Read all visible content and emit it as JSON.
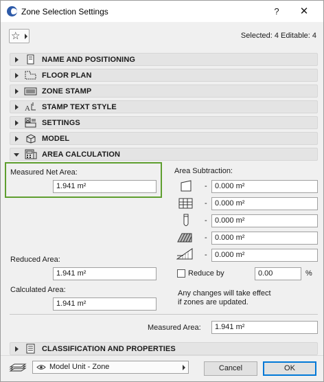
{
  "window": {
    "title": "Zone Selection Settings",
    "help": "?",
    "close": "✕"
  },
  "toolbar": {
    "favorites_icon": "star-icon",
    "selected_info": "Selected: 4 Editable: 4"
  },
  "panels": [
    {
      "label": "NAME AND POSITIONING",
      "icon": "name-positioning-icon",
      "expanded": false
    },
    {
      "label": "FLOOR PLAN",
      "icon": "floor-plan-icon",
      "expanded": false
    },
    {
      "label": "ZONE STAMP",
      "icon": "zone-stamp-icon",
      "expanded": false
    },
    {
      "label": "STAMP TEXT STYLE",
      "icon": "text-style-icon",
      "expanded": false
    },
    {
      "label": "SETTINGS",
      "icon": "settings-icon",
      "expanded": false
    },
    {
      "label": "MODEL",
      "icon": "model-icon",
      "expanded": false
    },
    {
      "label": "AREA CALCULATION",
      "icon": "area-calculation-icon",
      "expanded": true
    },
    {
      "label": "CLASSIFICATION AND PROPERTIES",
      "icon": "classification-icon",
      "expanded": false
    }
  ],
  "area": {
    "measured_net_label": "Measured Net Area:",
    "measured_net_value": "1.941 m²",
    "subtraction_label": "Area Subtraction:",
    "subtractions": [
      {
        "icon": "wall-niche-icon",
        "dash": "-",
        "value": "0.000 m²"
      },
      {
        "icon": "grid-icon",
        "dash": "-",
        "value": "0.000 m²"
      },
      {
        "icon": "column-icon",
        "dash": "-",
        "value": "0.000 m²"
      },
      {
        "icon": "hatched-fill-icon",
        "dash": "-",
        "value": "0.000 m²"
      },
      {
        "icon": "low-height-icon",
        "dash": "-",
        "value": "0.000 m²"
      }
    ],
    "reduced_label": "Reduced Area:",
    "reduced_value": "1.941 m²",
    "calculated_label": "Calculated Area:",
    "calculated_value": "1.941 m²",
    "reduce_by_label": "Reduce by",
    "reduce_by_checked": false,
    "reduce_by_value": "0.00",
    "reduce_by_unit": "%",
    "note_line1": "Any changes will take effect",
    "note_line2": "if zones are updated.",
    "measured_label": "Measured Area:",
    "measured_value": "1.941 m²"
  },
  "footer": {
    "layers_icon": "layers-icon",
    "visibility_icon": "eye-icon",
    "dropdown_value": "Model Unit - Zone",
    "cancel_label": "Cancel",
    "ok_label": "OK"
  },
  "colors": {
    "highlight": "#5e9e2e",
    "panel_bg": "#e4e4e4",
    "ok_border": "#0078d7"
  }
}
